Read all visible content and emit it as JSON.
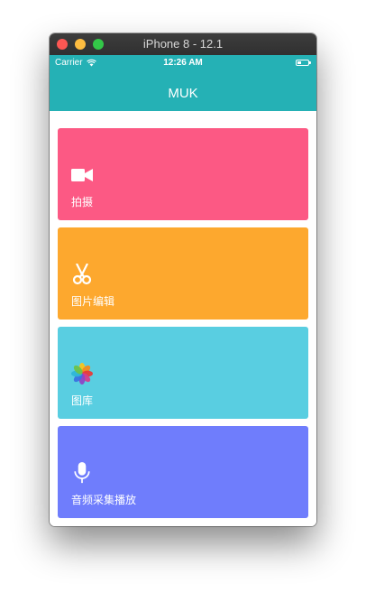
{
  "window": {
    "title": "iPhone 8 - 12.1"
  },
  "status_bar": {
    "carrier": "Carrier",
    "time": "12:26 AM"
  },
  "app_bar": {
    "title": "MUK",
    "color": "#25b1b5"
  },
  "cards": [
    {
      "label": "拍摄",
      "icon": "video-camera-icon",
      "color": "#fc5984"
    },
    {
      "label": "图片编辑",
      "icon": "scissors-icon",
      "color": "#fda82e"
    },
    {
      "label": "图库",
      "icon": "photos-icon",
      "color": "#59cee1"
    },
    {
      "label": "音频采集播放",
      "icon": "microphone-icon",
      "color": "#6f7dfc"
    }
  ]
}
